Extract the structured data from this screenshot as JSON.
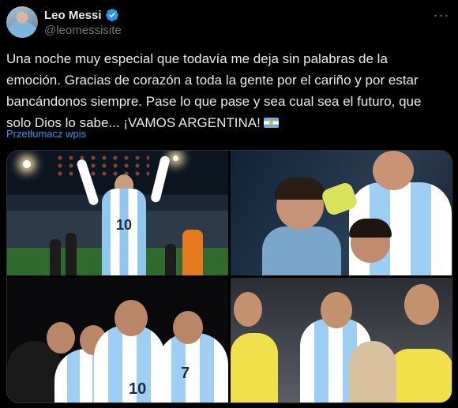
{
  "author": {
    "display_name": "Leo Messi",
    "handle": "@leomessisite",
    "verified_icon": "verified-badge-icon",
    "accent": "#1d9bf0"
  },
  "more_icon": "more-options-icon",
  "tweet": {
    "text": "Una noche muy especial que todavía me deja sin palabras de la emoción. Gracias de corazón a toda la gente por el cariño y por estar bancándonos siempre. Pase lo que pase y sea cual sea el futuro, que solo Dios lo sabe... ¡VAMOS ARGENTINA!",
    "emoji": "argentina-flag-icon",
    "translate_label": "Przetłumacz wpis"
  },
  "media": {
    "photos": [
      {
        "id": "photo-1",
        "jersey_number": "10"
      },
      {
        "id": "photo-2"
      },
      {
        "id": "photo-3",
        "jersey_numbers": [
          "10",
          "7"
        ]
      },
      {
        "id": "photo-4"
      }
    ]
  }
}
